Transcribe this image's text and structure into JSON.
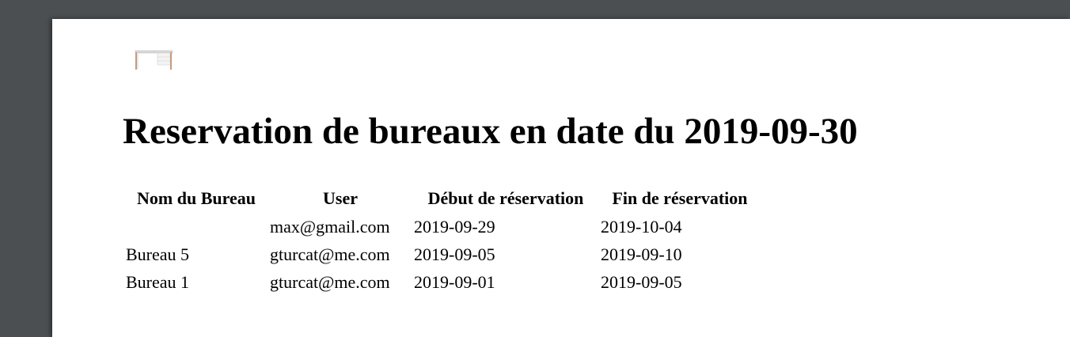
{
  "document": {
    "title": "Reservation de bureaux en date du 2019-09-30"
  },
  "image": {
    "icon": "desk-icon"
  },
  "table": {
    "headers": [
      "Nom du Bureau",
      "User",
      "Début de réservation",
      "Fin de réservation"
    ],
    "rows": [
      {
        "bureau": "",
        "user": "max@gmail.com",
        "debut": "2019-09-29",
        "fin": "2019-10-04"
      },
      {
        "bureau": "Bureau 5",
        "user": "gturcat@me.com",
        "debut": "2019-09-05",
        "fin": "2019-09-10"
      },
      {
        "bureau": "Bureau 1",
        "user": "gturcat@me.com",
        "debut": "2019-09-01",
        "fin": "2019-09-05"
      }
    ]
  }
}
